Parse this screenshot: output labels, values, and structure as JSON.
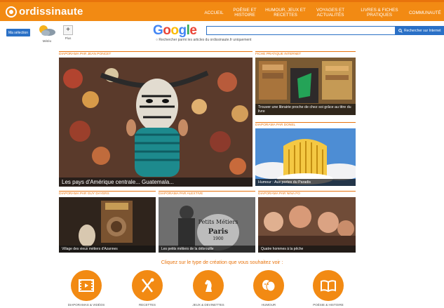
{
  "header": {
    "logo_text": "ordissinaute",
    "nav": [
      "ACCUEIL",
      "POÉSIE ET HISTOIRE",
      "HUMOUR, JEUX ET RECETTES",
      "VOYAGES ET ACTUALITÉS",
      "LIVRES & FICHES PRATIQUES",
      "COMMUNAUTÉ"
    ]
  },
  "toolbar": {
    "blue_button": "Ma sélection",
    "weather_label": "Météo",
    "plus_label": "Plus",
    "google_logo": "Google",
    "search_placeholder": "",
    "search_button": "Rechercher sur Internet",
    "search_note": "Rechercher parmi les articles du ordissinaute.fr uniquement"
  },
  "sections": {
    "main": "DIAPORAMA PAR JEAN PONCET",
    "pratique": "FICHE PRATIQUE INTERNET",
    "dessin": "DIAPORAMA PAR DONEL",
    "s1": "DIAPORAMA PAR GUY DAYERS",
    "s2": "DIAPORAMA PAR ALEXTIVE",
    "s3": "DIAPORAMA PAR NINA FO"
  },
  "tiles": {
    "main_caption": "Les pays d'Amérique centrale... Guatemala...",
    "pratique_caption": "Trouver une librairie proche de chez soi grâce au titre du livre",
    "dessin_caption": "Humour : Aux portes du Paradis",
    "s1_caption": "Village des vieux métiers d'Azannes",
    "s2_caption": "Les petits métiers de la débrouille",
    "s3_caption": "Quatre hommes à la pêche"
  },
  "cta": {
    "text": "Cliquez sur le type de création que vous souhaitez voir :",
    "items": [
      "DIAPORAMAS & VIDÉOS",
      "RECETTES",
      "JEUX & DEVINETTES",
      "HUMOUR",
      "POÉSIE & HISTOIRE"
    ]
  }
}
